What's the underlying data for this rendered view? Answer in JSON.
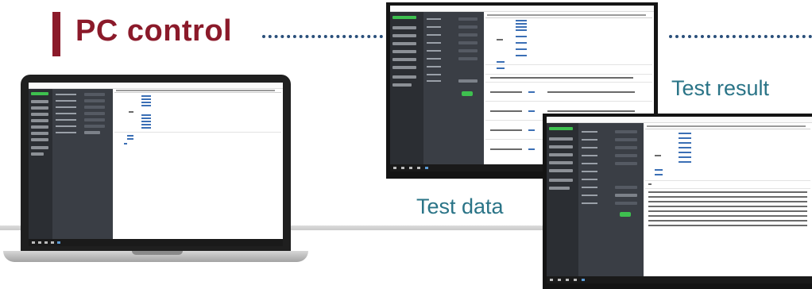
{
  "title": "PC control",
  "captions": {
    "test_result": "Test result",
    "test_data": "Test data"
  },
  "colors": {
    "title": "#8b1a2a",
    "caption": "#2a7487",
    "dots": "#2a4f7a",
    "app_nav": "#2b2e33",
    "app_panel": "#3a3e45",
    "accent": "#3ec04f"
  },
  "devices": [
    "laptop",
    "monitor-test-data",
    "monitor-test-result"
  ]
}
